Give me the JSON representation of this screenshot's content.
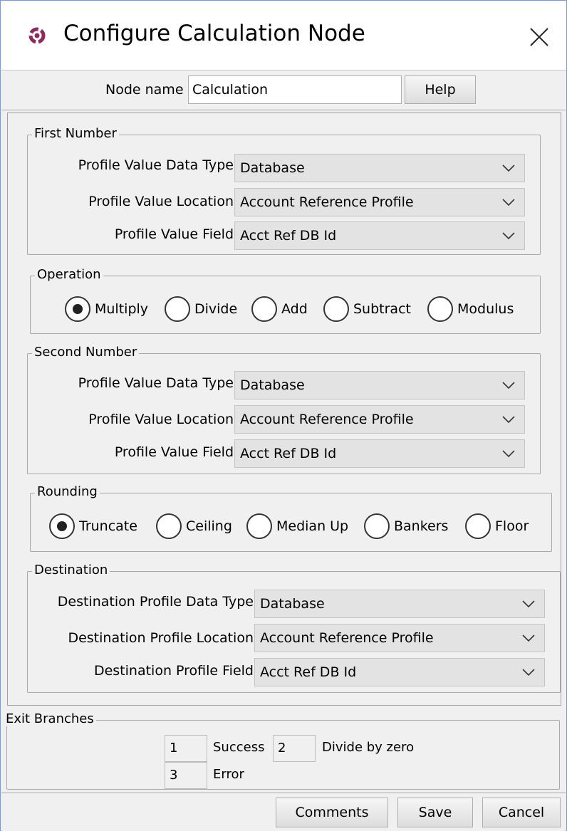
{
  "window": {
    "title": "Configure Calculation Node"
  },
  "header": {
    "node_name_label": "Node name",
    "node_name_value": "Calculation",
    "help_label": "Help"
  },
  "first_number": {
    "legend": "First Number",
    "data_type_label": "Profile Value Data Type",
    "data_type_value": "Database",
    "location_label": "Profile Value Location",
    "location_value": "Account Reference Profile",
    "field_label": "Profile Value Field",
    "field_value": "Acct Ref DB Id"
  },
  "operation": {
    "legend": "Operation",
    "options": [
      "Multiply",
      "Divide",
      "Add",
      "Subtract",
      "Modulus"
    ],
    "selected": "Multiply"
  },
  "second_number": {
    "legend": "Second Number",
    "data_type_label": "Profile Value Data Type",
    "data_type_value": "Database",
    "location_label": "Profile Value Location",
    "location_value": "Account Reference Profile",
    "field_label": "Profile Value Field",
    "field_value": "Acct Ref DB Id"
  },
  "rounding": {
    "legend": "Rounding",
    "options": [
      "Truncate",
      "Ceiling",
      "Median Up",
      "Bankers",
      "Floor"
    ],
    "selected": "Truncate"
  },
  "destination": {
    "legend": "Destination",
    "data_type_label": "Destination Profile Data Type",
    "data_type_value": "Database",
    "location_label": "Destination Profile Location",
    "location_value": "Account Reference Profile",
    "field_label": "Destination Profile Field",
    "field_value": "Acct Ref DB Id"
  },
  "exit_branches": {
    "legend": "Exit Branches",
    "success_number": "1",
    "success_label": "Success",
    "divide_number": "2",
    "divide_label": "Divide by zero",
    "error_number": "3",
    "error_label": "Error"
  },
  "buttons": {
    "comments": "Comments",
    "save": "Save",
    "cancel": "Cancel"
  },
  "colors": {
    "app_icon": "#8e2a5c",
    "panel_bg": "#f0f0f0",
    "combo_bg": "#e3e3e3"
  }
}
